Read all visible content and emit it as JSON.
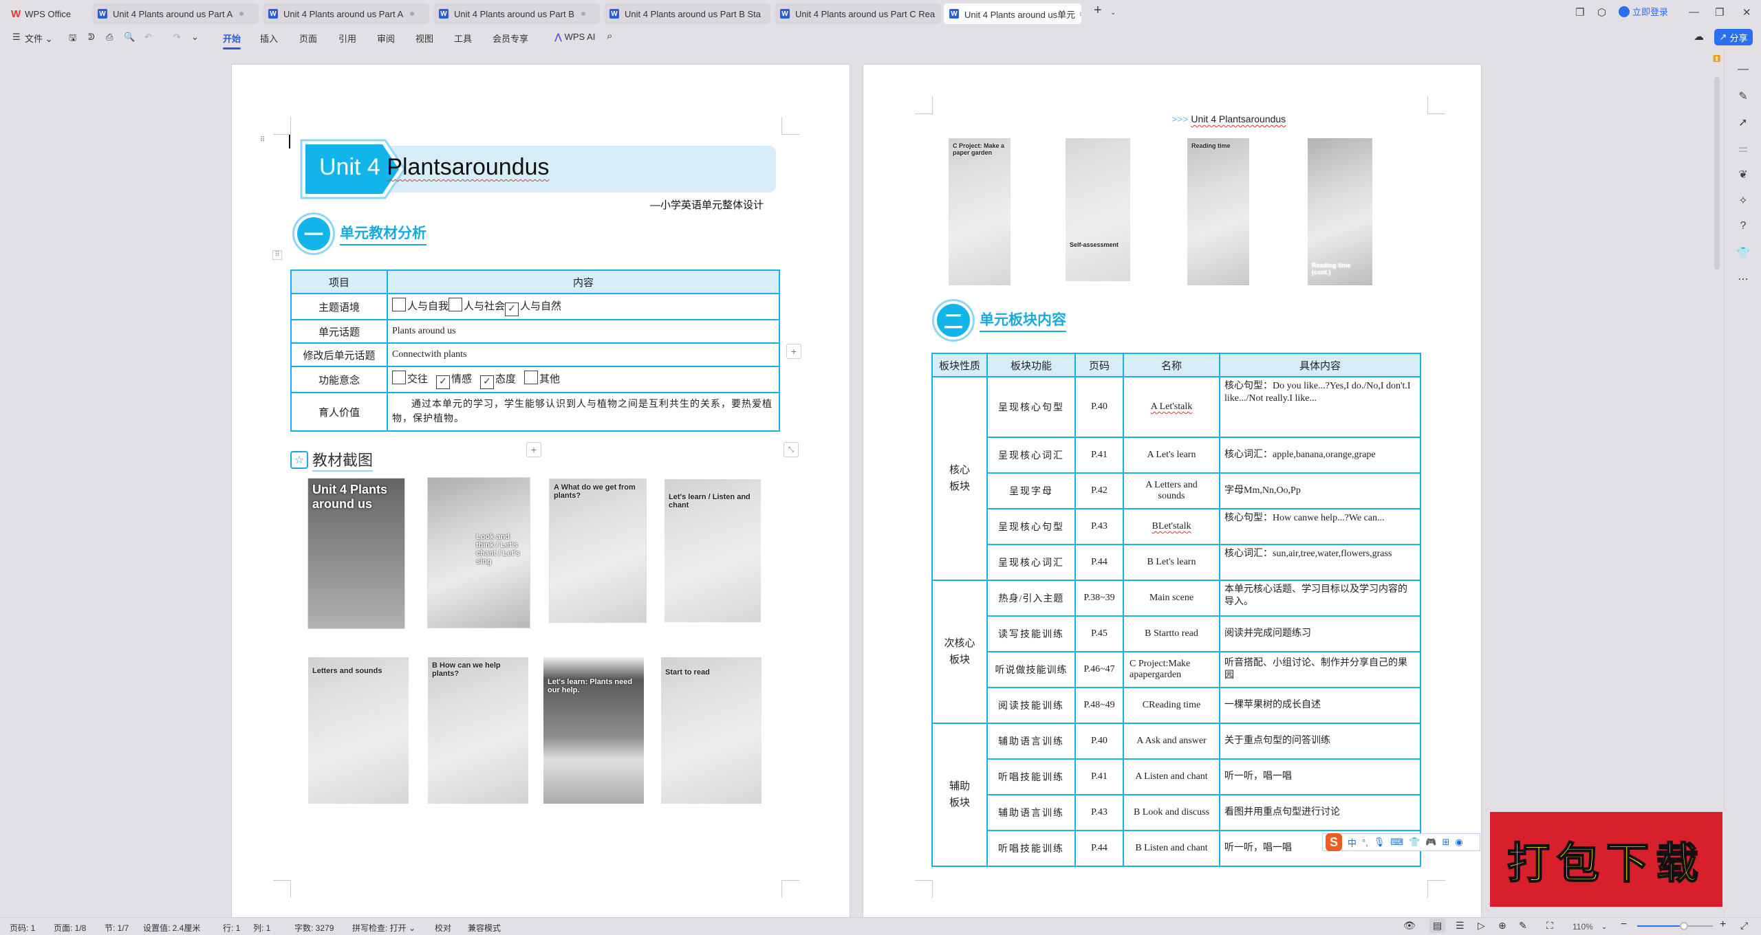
{
  "titlebar": {
    "app_tab": "WPS Office",
    "tabs": [
      {
        "label": "Unit 4  Plants around us Part A",
        "active": false
      },
      {
        "label": "Unit 4  Plants around us Part A",
        "active": false
      },
      {
        "label": "Unit 4  Plants around us Part B",
        "active": false
      },
      {
        "label": "Unit 4  Plants around us Part B Sta",
        "active": false
      },
      {
        "label": "Unit 4  Plants around us Part C Rea",
        "active": false
      },
      {
        "label": "Unit 4  Plants around us单元",
        "active": true
      }
    ],
    "new_tab": "+",
    "login": "立即登录"
  },
  "toolbar": {
    "file_menu": "文件",
    "ribbon_tabs": [
      "开始",
      "插入",
      "页面",
      "引用",
      "审阅",
      "视图",
      "工具",
      "会员专享"
    ],
    "active_tab": "开始",
    "wps_ai": "WPS AI",
    "share": "分享"
  },
  "left_page": {
    "banner": {
      "unit": "Unit 4 ",
      "title": "Plantsaroundus"
    },
    "subtitle": "—小学英语单元整体设计",
    "section1": {
      "num": "一",
      "title": "单元教材分析"
    },
    "table1": {
      "headers": [
        "项目",
        "内容"
      ],
      "theme_label": "主题语境",
      "theme_options": [
        {
          "label": "人与自我",
          "checked": false
        },
        {
          "label": "人与社会",
          "checked": false
        },
        {
          "label": "人与自然",
          "checked": true
        }
      ],
      "topic_label": "单元话题",
      "topic_value": "Plants around us",
      "revised_label": "修改后单元话题",
      "revised_value": "Connectwith plants",
      "function_label": "功能意念",
      "function_options": [
        {
          "label": "交往",
          "checked": false
        },
        {
          "label": "情感",
          "checked": true
        },
        {
          "label": "态度",
          "checked": true
        },
        {
          "label": "其他",
          "checked": false
        }
      ],
      "value_label": "育人价值",
      "value_text": "通过本单元的学习，学生能够认识到人与植物之间是互利共生的关系，要热爱植物，保护植物。"
    },
    "section_images": {
      "title": "教材截图"
    },
    "thumbnails": [
      "Unit 4 Plants around us",
      "Look and think / Let's chant / Let's sing",
      "A What do we get from plants?",
      "Let's learn / Listen and chant",
      "Letters and sounds",
      "B How can we help plants?",
      "Let's learn: Plants need our help.",
      "Start to read"
    ]
  },
  "right_page": {
    "header": {
      "prefix": ">>>",
      "text": "Unit 4 Plantsaroundus"
    },
    "thumbnails": [
      "C Project: Make a paper garden",
      "Self-assessment",
      "Reading time",
      "Reading time (cont.)"
    ],
    "section2": {
      "num": "二",
      "title": "单元板块内容"
    },
    "table2": {
      "headers": [
        "板块性质",
        "板块功能",
        "页码",
        "名称",
        "具体内容"
      ],
      "groups": [
        {
          "category": "核心板块",
          "rows": [
            {
              "func": "呈现核心句型",
              "page": "P.40",
              "name": "A Let'stalk",
              "detail": "核心句型：Do you like...?Yes,I do./No,I don't.I like.../Not really.I like..."
            },
            {
              "func": "呈现核心词汇",
              "page": "P.41",
              "name": "A Let's learn",
              "detail": "核心词汇：apple,banana,orange,grape"
            },
            {
              "func": "呈现字母",
              "page": "P.42",
              "name": "A Letters and sounds",
              "detail": "字母Mm,Nn,Oo,Pp"
            },
            {
              "func": "呈现核心句型",
              "page": "P.43",
              "name": "BLet'stalk",
              "detail": "核心句型：How canwe help...?We can..."
            },
            {
              "func": "呈现核心词汇",
              "page": "P.44",
              "name": "B Let's learn",
              "detail": "核心词汇：sun,air,tree,water,flowers,grass"
            }
          ]
        },
        {
          "category": "次核心板块",
          "rows": [
            {
              "func": "热身/引入主题",
              "page": "P.38~39",
              "name": "Main scene",
              "detail": "本单元核心话题、学习目标以及学习内容的导入。"
            },
            {
              "func": "读写技能训练",
              "page": "P.45",
              "name": "B Startto read",
              "detail": "阅读并完成问题练习"
            },
            {
              "func": "听说做技能训练",
              "page": "P.46~47",
              "name": "C Project:Make apapergarden",
              "detail": "听音搭配、小组讨论、制作并分享自己的果园"
            },
            {
              "func": "阅读技能训练",
              "page": "P.48~49",
              "name": "CReading time",
              "detail": "一棵苹果树的成长自述"
            }
          ]
        },
        {
          "category": "辅助板块",
          "rows": [
            {
              "func": "辅助语言训练",
              "page": "P.40",
              "name": "A Ask and answer",
              "detail": "关于重点句型的问答训练"
            },
            {
              "func": "听唱技能训练",
              "page": "P.41",
              "name": "A Listen and chant",
              "detail": "听一听，唱一唱"
            },
            {
              "func": "辅助语言训练",
              "page": "P.43",
              "name": "B Look and discuss",
              "detail": "看图并用重点句型进行讨论"
            },
            {
              "func": "听唱技能训练",
              "page": "P.44",
              "name": "B Listen and chant",
              "detail": "听一听，唱一唱"
            }
          ]
        }
      ]
    }
  },
  "ime": {
    "logo": "S",
    "mode": "中",
    "punct": "°,"
  },
  "stamp": {
    "text": "打包下载"
  },
  "statusbar": {
    "page_num": "页码: 1",
    "pages": "页面: 1/8",
    "section": "节: 1/7",
    "setting": "设置值: 2.4厘米",
    "row": "行: 1",
    "col": "列: 1",
    "words": "字数: 3279",
    "spell": "拼写检查: 打开",
    "proof": "校对",
    "compat": "兼容模式",
    "zoom": "110%",
    "zoom_fraction": 0.62
  }
}
